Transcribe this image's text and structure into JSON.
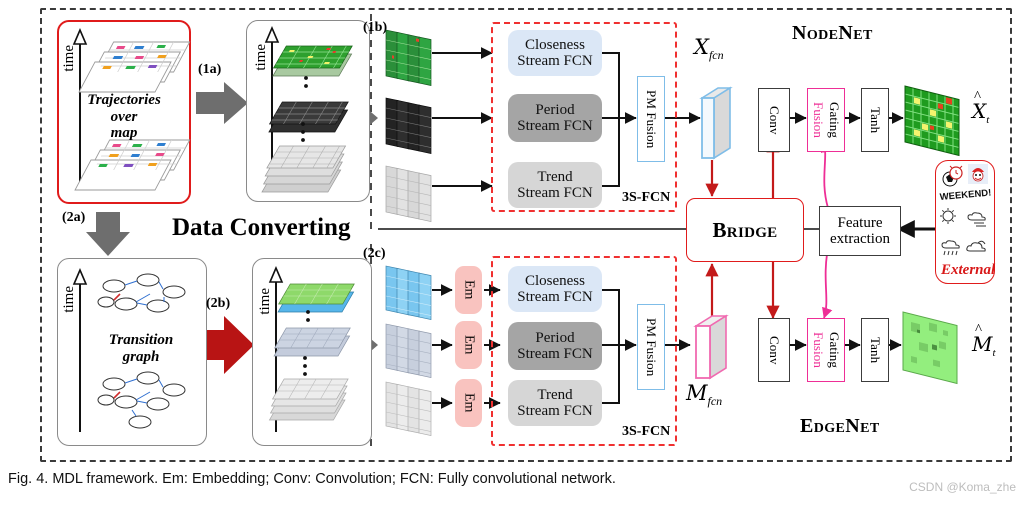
{
  "figure": {
    "caption": "Fig. 4. MDL framework. Em: Embedding; Conv: Convolution; FCN: Fully convolutional network.",
    "watermark": "CSDN @Koma_zhe"
  },
  "labels": {
    "step_1a": "(1a)",
    "step_1b": "(1b)",
    "step_2a": "(2a)",
    "step_2b": "(2b)",
    "step_2c": "(2c)",
    "data_converting": "Data Converting",
    "time_axis": "time"
  },
  "inputs": {
    "trajectories": "Trajectories over map",
    "trajectories_l1": "Trajectories",
    "trajectories_l2": "over",
    "trajectories_l3": "map",
    "transition": "Transition graph",
    "transition_l1": "Transition",
    "transition_l2": "graph"
  },
  "node_net": {
    "title": "NodeNet",
    "streams": [
      {
        "name": "closeness",
        "l1": "Closeness",
        "l2": "Stream FCN",
        "color": "#dbe7f6"
      },
      {
        "name": "period",
        "l1": "Period",
        "l2": "Stream FCN",
        "color": "#a5a5a5"
      },
      {
        "name": "trend",
        "l1": "Trend",
        "l2": "Stream FCN",
        "color": "#d6d6d6"
      }
    ],
    "pm_fusion": "PM Fusion",
    "group_label": "3S-FCN",
    "feature_map": "X",
    "feature_map_sub": "fcn",
    "conv": "Conv",
    "gating_l1": "Gating",
    "gating_l2": "Fusion",
    "tanh": "Tanh",
    "output": "X",
    "output_sub": "t"
  },
  "edge_net": {
    "title": "EdgeNet",
    "embedding": "Em",
    "streams": [
      {
        "name": "closeness",
        "l1": "Closeness",
        "l2": "Stream FCN",
        "color": "#dbe7f6"
      },
      {
        "name": "period",
        "l1": "Period",
        "l2": "Stream FCN",
        "color": "#a5a5a5"
      },
      {
        "name": "trend",
        "l1": "Trend",
        "l2": "Stream FCN",
        "color": "#d6d6d6"
      }
    ],
    "pm_fusion": "PM Fusion",
    "group_label": "3S-FCN",
    "feature_map": "M",
    "feature_map_sub": "fcn",
    "conv": "Conv",
    "gating_l1": "Gating",
    "gating_l2": "Fusion",
    "tanh": "Tanh",
    "output": "M",
    "output_sub": "t"
  },
  "bridge": {
    "label": "Bridge"
  },
  "feature_extraction": {
    "l1": "Feature",
    "l2": "extraction"
  },
  "external": {
    "label": "External",
    "weekend_text": "WEEKEND!",
    "icons": [
      "soccer-ball-icon",
      "santa-icon",
      "weekend-banner-icon",
      "sun-icon",
      "wind-cloud-icon",
      "rain-cloud-icon",
      "partly-cloudy-icon"
    ]
  },
  "colors": {
    "accent_red": "#e01b1b",
    "dashed_red": "#f03030",
    "pink": "#ee2e96",
    "light_blue": "#7fbde8",
    "em_pink": "#f9c3bf",
    "arrow_gray": "#6e6e6e",
    "dark_red_arrow": "#b81414",
    "green_map": "#2fa32f",
    "light_green_map": "#95e887"
  }
}
